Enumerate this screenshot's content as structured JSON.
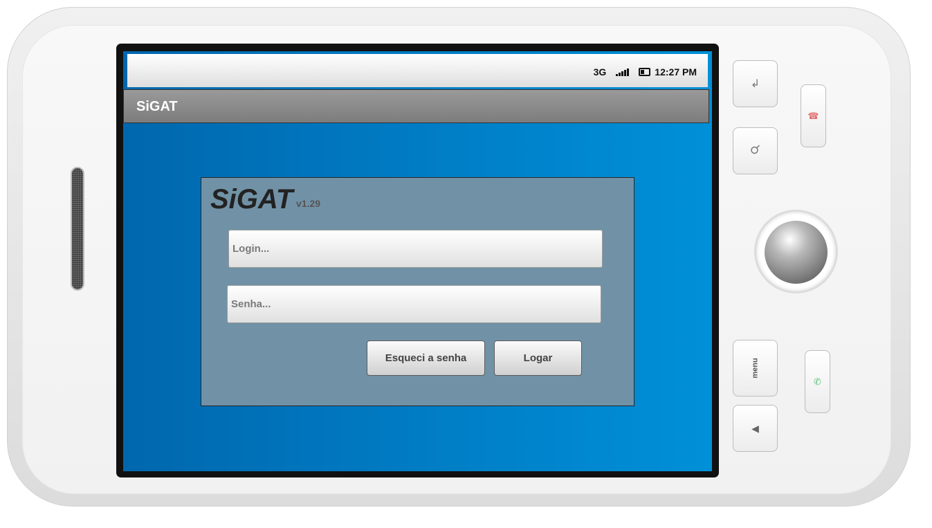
{
  "status_bar": {
    "network": "3G",
    "time": "12:27 PM"
  },
  "app_title": "SiGAT",
  "login_panel": {
    "brand": "SiGAT",
    "version": "v1.29",
    "login_placeholder": "Login...",
    "password_placeholder": "Senha...",
    "forgot_button": "Esqueci a senha",
    "login_button": "Logar"
  },
  "hardware_keys": {
    "menu_label": "menu"
  },
  "icons": {
    "signal": "signal-icon",
    "battery": "battery-icon",
    "search": "search-icon",
    "end_call": "end-call-icon",
    "call": "call-icon",
    "back": "back-icon"
  },
  "colors": {
    "screen_blue": "#0078c0",
    "panel": "#7192a6",
    "title_bar": "#8a8a8a"
  }
}
